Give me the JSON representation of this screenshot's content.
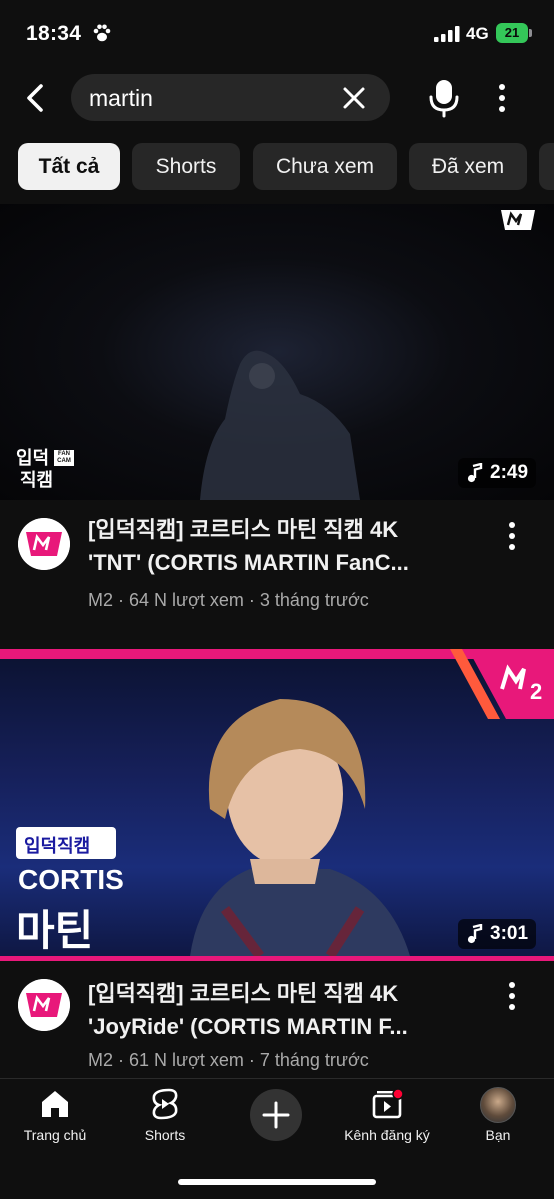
{
  "status": {
    "time": "18:34",
    "network": "4G",
    "battery": "21"
  },
  "search": {
    "query": "martin"
  },
  "chips": [
    {
      "label": "Tất cả",
      "active": true
    },
    {
      "label": "Shorts",
      "active": false
    },
    {
      "label": "Chưa xem",
      "active": false
    },
    {
      "label": "Đã xem",
      "active": false
    }
  ],
  "videos": [
    {
      "title_line1": "[입덕직캠] 코르티스 마틴 직캠 4K",
      "title_line2": "'TNT' (CORTIS MARTIN FanC...",
      "channel": "M2",
      "meta": "M2 · 64 N lượt xem · 3 tháng trước",
      "duration": "2:49",
      "badge_top": "입덕",
      "badge_bottom": "직캠",
      "badge_side": "FAN CAM"
    },
    {
      "title_line1": "[입덕직캠] 코르티스 마틴 직캠 4K",
      "title_line2": "'JoyRide' (CORTIS MARTIN F...",
      "channel": "M2",
      "meta": "M2 · 61 N lượt xem · 7 tháng trước",
      "duration": "3:01",
      "overlay_tag": "입덕직캠",
      "overlay_group": "CORTIS",
      "overlay_name": "마틴"
    }
  ],
  "bottom_nav": {
    "home": "Trang chủ",
    "shorts": "Shorts",
    "subscriptions": "Kênh đăng ký",
    "you": "Bạn"
  },
  "colors": {
    "background": "#0f0f0f",
    "chip": "#272727",
    "m2_pink": "#e8187a",
    "notification": "#ff0033"
  }
}
